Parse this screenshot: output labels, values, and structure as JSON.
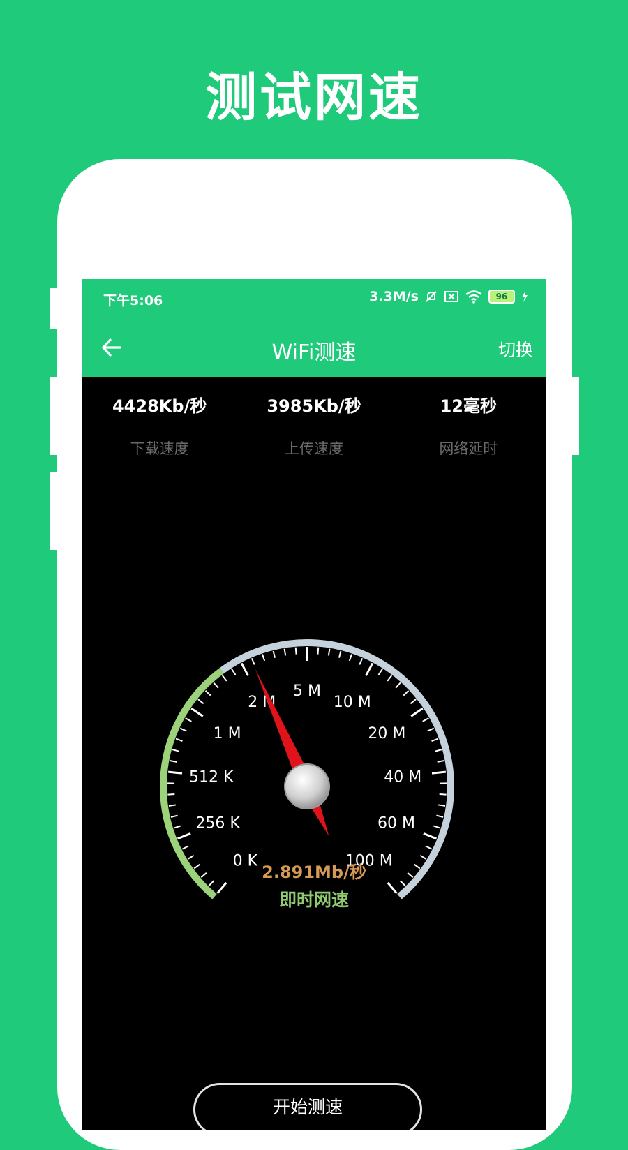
{
  "promo": {
    "title": "测试网速"
  },
  "status_bar": {
    "time": "下午5:06",
    "net_speed": "3.3M/s",
    "battery": "96"
  },
  "app_bar": {
    "back_icon": "arrow-left-icon",
    "title": "WiFi测速",
    "switch_label": "切换"
  },
  "stats": [
    {
      "value": "4428Kb/秒",
      "label": "下载速度"
    },
    {
      "value": "3985Kb/秒",
      "label": "上传速度"
    },
    {
      "value": "12毫秒",
      "label": "网络延时"
    }
  ],
  "gauge": {
    "labels_left": [
      "0 K",
      "256 K",
      "512 K",
      "1 M",
      "2 M"
    ],
    "label_top": "5 M",
    "labels_right": [
      "10 M",
      "20 M",
      "40 M",
      "60 M",
      "100 M"
    ],
    "needle_fraction": 0.415,
    "progress_fraction": 0.37,
    "colors": {
      "progress": "#9cd27a",
      "track": "#c5d2dc",
      "needle": "#e0121a"
    }
  },
  "speed": {
    "value": "2.891Mb/秒",
    "label": "即时网速"
  },
  "start_button": {
    "label": "开始测速"
  }
}
